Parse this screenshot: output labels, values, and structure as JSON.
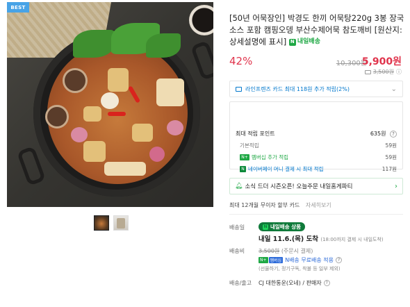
{
  "image": {
    "badge": "BEST"
  },
  "product": {
    "title": "[50년 어묵장인] 박경도 한끼 어묵탕220g 3봉 장국소스 포함 캠핑오뎅 부산수제어묵 참도깨비 [원산지:상세설명에 표시]",
    "today_delivery_tag": "내일배송"
  },
  "price": {
    "discount": "42%",
    "original": "10,300원",
    "final": "5,900원",
    "shipping_struck": "3,500원"
  },
  "card_benefit": {
    "text": "라인프렌즈 카드 최대 118원 추가 적립(2%)"
  },
  "points": {
    "header_label": "최대 적립 포인트",
    "header_value": "635원",
    "rows": [
      {
        "label": "기본적립",
        "value": "59원"
      },
      {
        "label": "멤버십 추가 적립",
        "value": "59원"
      },
      {
        "label": "네이버페이 머니 결제 시 최대 적립",
        "value": "117원"
      }
    ]
  },
  "notice": {
    "text": "소식 드더 시즌오픈! 오늘주문 내일홈게파티"
  },
  "installment": {
    "text": "최대 12개월 무이자 할부 카드",
    "more": "자세히보기"
  },
  "delivery": {
    "label": "배송일",
    "badge": "내일배송 상품",
    "arrive": "내일 11.6.(목) 도착",
    "arrive_note": "(18:00까지 결제 시 내일도착)"
  },
  "fee": {
    "label": "배송비",
    "amount": "3,500원",
    "cond": "(주문시 결제)",
    "free_text": "N배송 무료배송 적용",
    "free_sub": "(선물하기, 정기구독, 착불 등 일부 제외)"
  },
  "carrier": {
    "label": "배송/출고",
    "text": "CJ 대한통운(오네) / 판매자"
  },
  "colors": {
    "price_red": "#e0344c",
    "naver_green": "#1fa845",
    "link_blue": "#0077cc"
  }
}
